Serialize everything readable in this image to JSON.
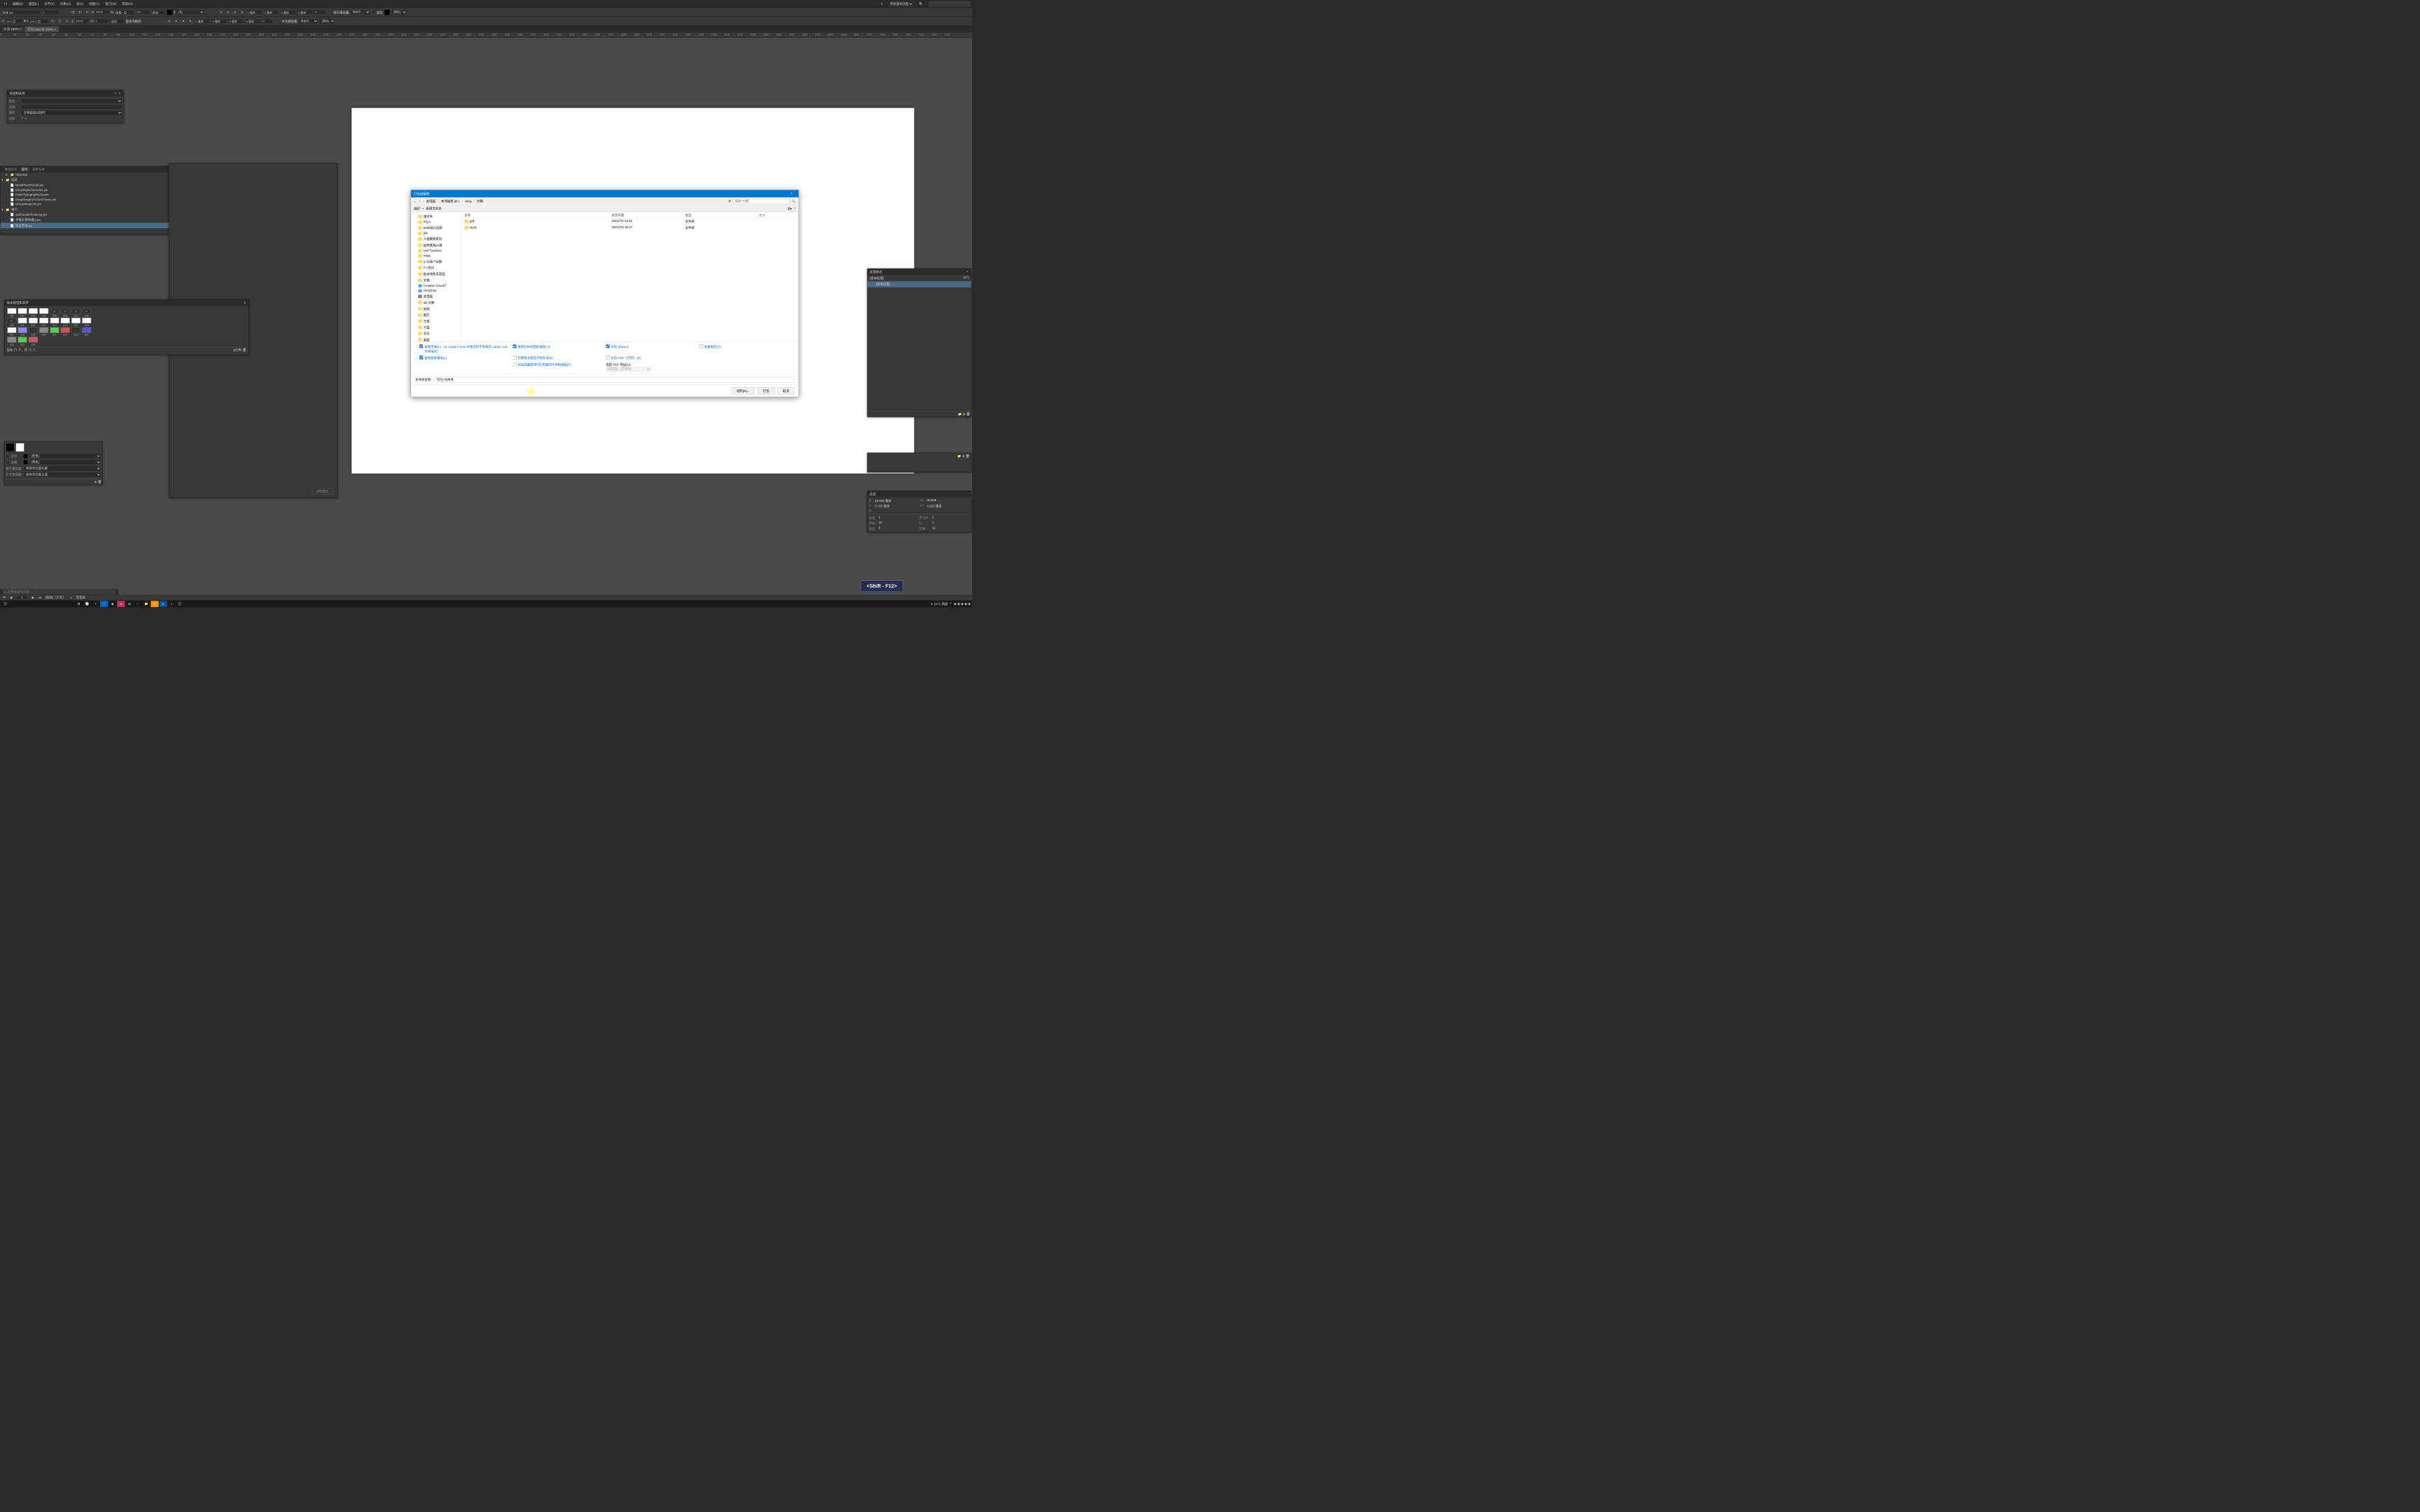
{
  "menubar": {
    "items": [
      "F)",
      "编辑(E)",
      "版面(L)",
      "文字(T)",
      "对象(O)",
      "表(A)",
      "视图(V)",
      "窗口(W)",
      "帮助(H)"
    ],
    "workspace_dropdown": "传统基本功能",
    "search_placeholder": ""
  },
  "control1": {
    "font": "宋体 Std",
    "style": "L",
    "size": "14.4 点",
    "leading": "(14.4 点)",
    "scale_v": "100%",
    "scale_h": "100%",
    "tracking": "0",
    "kerning": "度量 - 仅",
    "baseline": "0%",
    "skew": "自动",
    "char_style": "[无]",
    "story_direction": "直排内横排",
    "rotation": "自动",
    "margin_top": "0 毫米",
    "margin_bottom": "0 毫米",
    "margin_left": "0 毫米",
    "margin_right": "0 毫米",
    "indent1": "0 毫米",
    "indent2": "0 毫米",
    "indent3": "0 毫米",
    "indent4": "0",
    "more1": "0",
    "hanging_label": "避头尾设置:",
    "hanging": "简体中...",
    "mojikumi_label": "中文排版集:",
    "mojikumi": "简体中...",
    "stroke_label": "底纹",
    "stroke_color": "[黑色]",
    "fill_color": "[黑色]"
  },
  "doc_tabs": [
    {
      "label": "d @ 150% ×",
      "active": false
    },
    {
      "label": "打包.indd @ 200% ×",
      "active": true
    }
  ],
  "ruler_marks": [
    "0",
    "10",
    "20",
    "30",
    "40",
    "50",
    "60",
    "70",
    "80",
    "90",
    "100",
    "110",
    "120",
    "130",
    "140",
    "150",
    "160",
    "170",
    "180",
    "190",
    "200",
    "210",
    "220",
    "230",
    "240",
    "250",
    "260",
    "270",
    "280",
    "290",
    "300",
    "310",
    "320",
    "330",
    "340",
    "350",
    "360",
    "370",
    "380",
    "390",
    "400",
    "410",
    "420",
    "430",
    "440",
    "450",
    "460",
    "470",
    "480",
    "490",
    "500",
    "510",
    "520",
    "530",
    "540",
    "550",
    "560",
    "570",
    "580",
    "590",
    "600",
    "610",
    "620",
    "630",
    "640",
    "650",
    "660",
    "670",
    "680",
    "690",
    "700",
    "710",
    "720",
    "730"
  ],
  "panel_buttons": {
    "title": "按钮和表单",
    "rows": [
      {
        "label": "类型:",
        "value": ""
      },
      {
        "label": "名称:",
        "value": ""
      },
      {
        "label": "事件:",
        "value": "在释放或点按时"
      },
      {
        "label": "动作:",
        "value": "+  —"
      }
    ]
  },
  "panel_scripts": {
    "tabs": [
      "数据合并",
      "脚本",
      "脚本标签"
    ],
    "active_tab": "脚本",
    "tree": [
      {
        "type": "folder",
        "label": "VBScript",
        "indent": 1
      },
      {
        "type": "folder",
        "label": "社区",
        "indent": 0,
        "open": true
      },
      {
        "type": "script",
        "label": "BreakTextThread.jsx",
        "indent": 1
      },
      {
        "type": "script",
        "label": "ClearStyleOverrides.jsx",
        "indent": 1
      },
      {
        "type": "script",
        "label": "InsertTypographerQuote",
        "indent": 1
      },
      {
        "type": "script",
        "label": "SnapMarginsToTextFrame.jsx",
        "indent": 1
      },
      {
        "type": "script",
        "label": "UnicodeInjector.jsx",
        "indent": 1
      },
      {
        "type": "folder",
        "label": "用户",
        "indent": 0,
        "open": true
      },
      {
        "type": "script",
        "label": "qudiaoqianhoukong.jsx",
        "indent": 1
      },
      {
        "type": "script",
        "label": "半角全角转换js.jsx",
        "indent": 1
      },
      {
        "type": "script",
        "label": "导出字体.jsx",
        "indent": 1,
        "selected": true
      }
    ]
  },
  "panel_samples": {
    "title": "样本按钮和表单",
    "items": [
      {
        "id": "001"
      },
      {
        "id": "002"
      },
      {
        "id": "003"
      },
      {
        "id": "004"
      },
      {
        "id": "005"
      },
      {
        "id": "006"
      },
      {
        "id": "007"
      },
      {
        "id": "008"
      },
      {
        "id": "009"
      },
      {
        "id": "010"
      },
      {
        "id": "011"
      },
      {
        "id": "012"
      },
      {
        "id": "013"
      },
      {
        "id": "014"
      },
      {
        "id": "015"
      },
      {
        "id": "016"
      },
      {
        "id": "017"
      },
      {
        "id": "018"
      },
      {
        "id": "019"
      },
      {
        "id": "020"
      },
      {
        "id": "021"
      },
      {
        "id": "022"
      },
      {
        "id": "023"
      },
      {
        "id": "024"
      },
      {
        "id": "025"
      },
      {
        "id": "101"
      },
      {
        "id": "102"
      }
    ],
    "status": "显示 77 个，共 77 个"
  },
  "panel_appearance": {
    "underline_label": "底纹",
    "underline_color": "[黑色]",
    "border_label": "边框",
    "border_color": "[黑色]",
    "hanging_label": "避头尾设置:",
    "hanging": "简体中文避头尾",
    "mojikumi_label": "中文排版集:",
    "mojikumi": "简体中文默认值"
  },
  "panel_para": {
    "title": "段落样式",
    "basic": "[基本段落]",
    "items": [
      "[基本段落]"
    ]
  },
  "panel_info": {
    "title": "信息",
    "x_label": "X:",
    "x": "26.839 毫米",
    "y_label": "Y:",
    "y": "3.725 毫米",
    "d_label": "D:",
    "d": "",
    "w_label": "W:",
    "w": "45.805 ...",
    "h_label": "H:",
    "h": "4.233 毫米",
    "fullangle_label": "全角:",
    "fullangle": "2",
    "halfangle_label": "半角:",
    "halfangle": "10",
    "other_label": "假名:",
    "other": "0",
    "roman_label": "罗马字:",
    "roman": "2",
    "rows_label": "行:",
    "rows": "1",
    "chars_label": "字数:",
    "chars": "12"
  },
  "dialog": {
    "title": "打包出版物",
    "breadcrumb": [
      "此电脑",
      "本地磁盘 (D:)",
      "wing",
      "文稿"
    ],
    "search_placeholder": "搜索\"文稿\"",
    "toolbar": {
      "organize": "组织",
      "newfolder": "新建文件夹"
    },
    "nav": [
      {
        "icon": "folder",
        "label": "课文件"
      },
      {
        "icon": "folder",
        "label": "P524"
      },
      {
        "icon": "folder",
        "label": "2006幼儿园彩"
      },
      {
        "icon": "folder",
        "label": "pld"
      },
      {
        "icon": "folder",
        "label": "人物模特系列"
      },
      {
        "icon": "folder",
        "label": "园林景观ps源"
      },
      {
        "icon": "folder",
        "label": "146 Toyokuni"
      },
      {
        "icon": "folder",
        "label": "T094"
      },
      {
        "icon": "folder",
        "label": "6.30用户手册"
      },
      {
        "icon": "folder",
        "label": "7.7合同"
      },
      {
        "icon": "folder",
        "label": "粘米线性炭选型"
      },
      {
        "icon": "folder",
        "label": "文稿"
      },
      {
        "icon": "cloud",
        "label": "Creative Cloud F"
      },
      {
        "icon": "cloud",
        "label": "OneDrive"
      },
      {
        "icon": "pc",
        "label": "此电脑"
      },
      {
        "icon": "3d",
        "label": "3D 对象"
      },
      {
        "icon": "video",
        "label": "视频"
      },
      {
        "icon": "image",
        "label": "图片"
      },
      {
        "icon": "doc",
        "label": "文档"
      },
      {
        "icon": "download",
        "label": "下载"
      },
      {
        "icon": "music",
        "label": "音乐"
      },
      {
        "icon": "desktop",
        "label": "桌面"
      },
      {
        "icon": "drive",
        "label": "本地磁盘 (C:)"
      },
      {
        "icon": "drive",
        "label": "本地磁盘 (D:)"
      }
    ],
    "columns": {
      "name": "名称",
      "date": "修改日期",
      "type": "类型",
      "size": "大小"
    },
    "files": [
      {
        "name": "pdf",
        "date": "2021/7/2 13:21",
        "type": "文件夹",
        "size": ""
      },
      {
        "name": "word",
        "date": "2021/7/5 18:17",
        "type": "文件夹",
        "size": ""
      }
    ],
    "options": [
      {
        "label": "复制字体(C)（从 Adobe Fonts 中激活的字体和非 Adobe CJK 字体除外）",
        "checked": true
      },
      {
        "label": "更新包中的图形链接(U)",
        "checked": true
      },
      {
        "label": "包括 IDML(I)",
        "checked": true
      },
      {
        "label": "查看报告(V)",
        "checked": false
      },
      {
        "label": "复制链接图形(L)",
        "checked": true
      },
      {
        "label": "仅使用文档连字例外项(D)",
        "checked": false
      },
      {
        "label": "包括 PDF（打印）(R)",
        "checked": false
      },
      {
        "label": "",
        "checked": false
      },
      {
        "label": "",
        "checked": false
      },
      {
        "label": "包括隐藏和非打印内容的字体和链接(F)",
        "checked": false
      }
    ],
    "pdf_preset_label": "选择 PDF 预设(S):",
    "pdf_preset": "[高质量]（已修改）",
    "filename_label": "文件夹名称:",
    "filename": "\"打包\"文件夹",
    "buttons": {
      "instructions": "说明(N)...",
      "package": "打包",
      "cancel": "取消"
    }
  },
  "preflight_btn": "调附报告",
  "statusbar": {
    "page": "1",
    "master": "[基本]（工作）",
    "preflight": "无错误"
  },
  "searchbar_placeholder": "入您要搜索的内容",
  "taskbar": {
    "weather": "29°C 晴朗",
    "time": ""
  },
  "kbd_hint": "<Shift - F12>"
}
